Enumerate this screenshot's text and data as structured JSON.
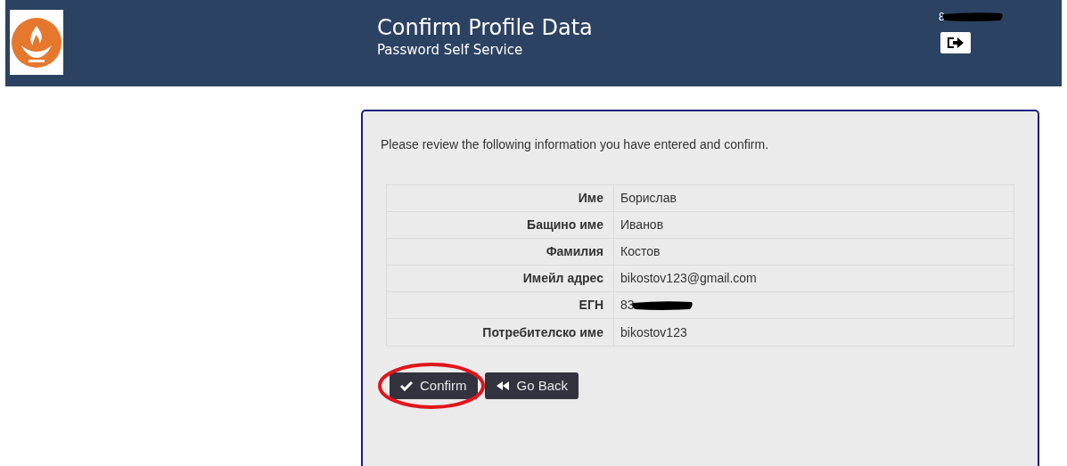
{
  "header": {
    "title": "Confirm Profile Data",
    "subtitle": "Password Self Service",
    "user": "8"
  },
  "panel": {
    "message": "Please review the following information you have entered and confirm.",
    "rows": [
      {
        "label": "Име",
        "value": "Борислав",
        "redacted": false
      },
      {
        "label": "Бащино име",
        "value": "Иванов",
        "redacted": false
      },
      {
        "label": "Фамилия",
        "value": "Костов",
        "redacted": false
      },
      {
        "label": "Имейл адрес",
        "value": "bikostov123@gmail.com",
        "redacted": false
      },
      {
        "label": "ЕГН",
        "value": "83",
        "redacted": true
      },
      {
        "label": "Потребителско име",
        "value": "bikostov123",
        "redacted": false
      }
    ],
    "buttons": [
      {
        "kind": "confirm",
        "label": "Confirm",
        "highlighted": true
      },
      {
        "kind": "back",
        "label": "Go Back",
        "highlighted": false
      }
    ]
  }
}
